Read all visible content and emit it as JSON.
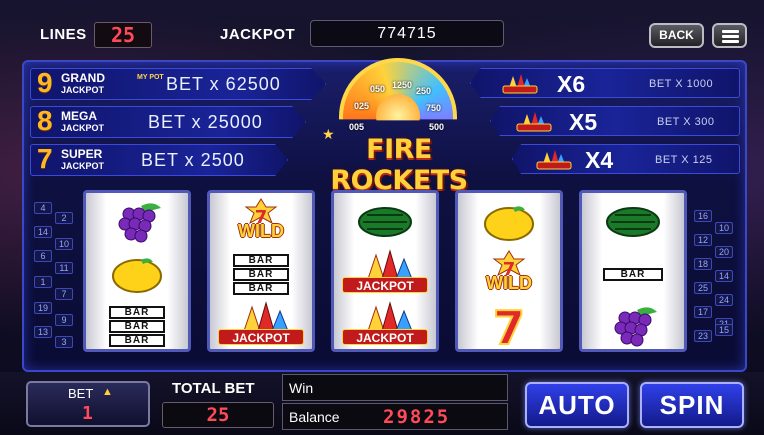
{
  "header": {
    "lines_label": "LINES",
    "lines_value": "25",
    "jackpot_label": "JACKPOT",
    "jackpot_value": "774715",
    "back_label": "BACK"
  },
  "jackpots": [
    {
      "num": "9",
      "name_top": "GRAND",
      "name_bottom": "JACKPOT",
      "bet": "BET x 62500"
    },
    {
      "num": "8",
      "name_top": "MEGA",
      "name_bottom": "JACKPOT",
      "bet": "BET x 25000"
    },
    {
      "num": "7",
      "name_top": "SUPER",
      "name_bottom": "JACKPOT",
      "bet": "BET x 2500"
    }
  ],
  "my_pot": "MY POT",
  "payouts": [
    {
      "mult": "X6",
      "bet": "BET X 1000"
    },
    {
      "mult": "X5",
      "bet": "BET X 300"
    },
    {
      "mult": "X4",
      "bet": "BET X 125"
    }
  ],
  "logo": {
    "title": "FIRE ROCKETS",
    "wheel_values": [
      "005",
      "025",
      "050",
      "1250",
      "250",
      "750",
      "500"
    ]
  },
  "line_numbers_left": [
    "4",
    "2",
    "14",
    "10",
    "6",
    "11",
    "1",
    "7",
    "19",
    "9",
    "13",
    "3"
  ],
  "line_numbers_right": [
    "16",
    "10",
    "12",
    "20",
    "18",
    "14",
    "25",
    "24",
    "17",
    "21",
    "23",
    "15"
  ],
  "reels": [
    [
      "grapes",
      "lemon",
      "bar3"
    ],
    [
      "wild",
      "bar3",
      "jackpot"
    ],
    [
      "watermelon",
      "jackpot",
      "jackpot"
    ],
    [
      "lemon",
      "wild",
      "seven"
    ],
    [
      "watermelon",
      "bar1",
      "grapes"
    ]
  ],
  "symbol_text": {
    "bar": "BAR",
    "wild": "WILD",
    "jackpot": "JACKPOT"
  },
  "bottom": {
    "bet_label": "BET",
    "bet_value": "1",
    "total_bet_label": "TOTAL BET",
    "total_bet_value": "25",
    "win_label": "Win",
    "balance_label": "Balance",
    "balance_value": "29825",
    "auto_label": "AUTO",
    "spin_label": "SPIN"
  },
  "colors": {
    "accent_gold": "#ffd23a",
    "panel_blue": "#1a2498",
    "digit_red": "#ff4a5a"
  }
}
